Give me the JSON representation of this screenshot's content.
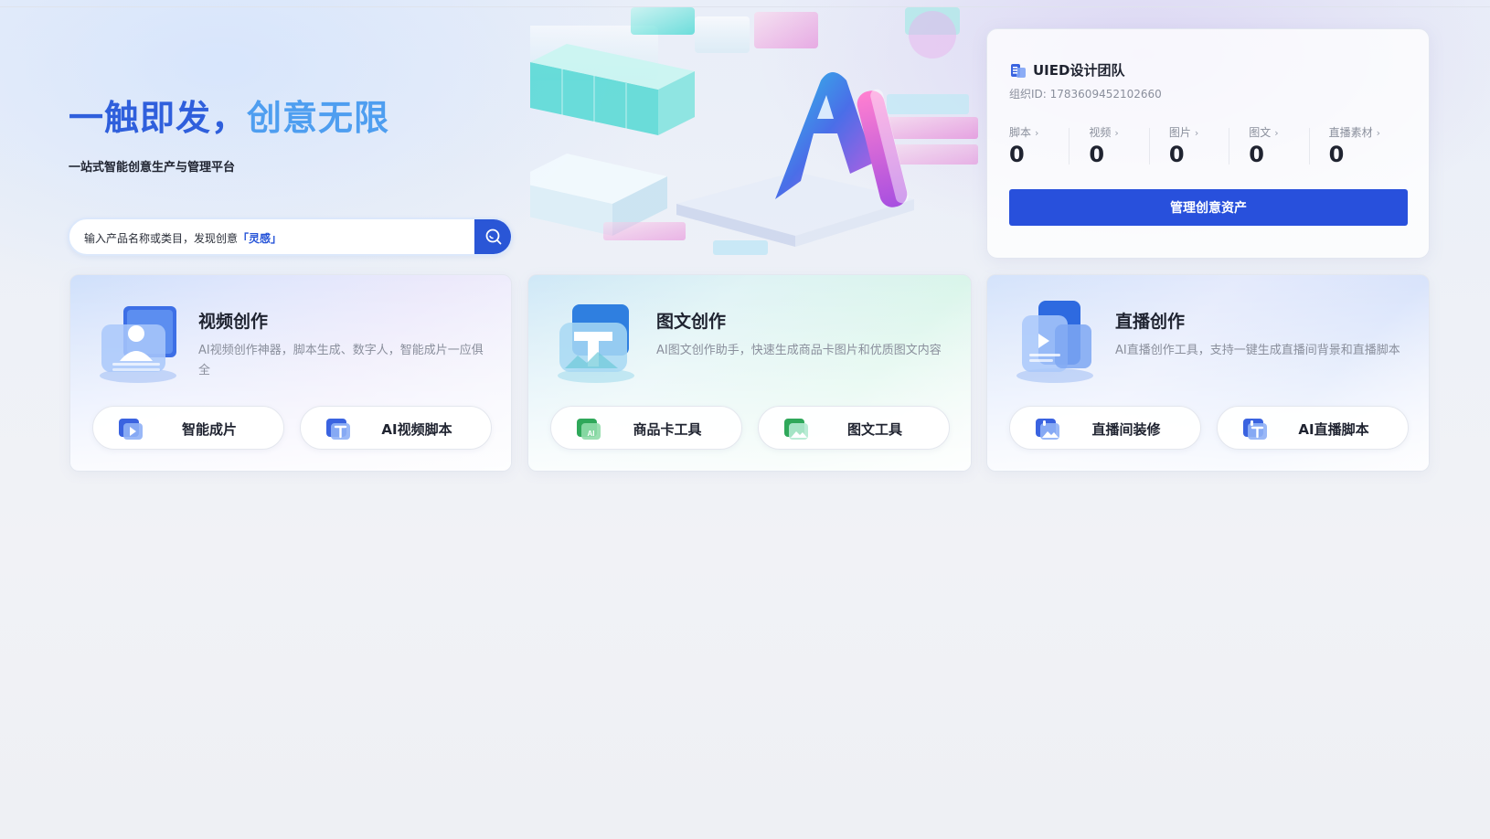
{
  "hero": {
    "title_part1": "一触即发，",
    "title_part2": "创意无限",
    "subtitle": "一站式智能创意生产与管理平台",
    "search_placeholder_text": "输入产品名称或类目，发现创意",
    "search_placeholder_highlight": "「灵感」"
  },
  "team": {
    "name": "UIED设计团队",
    "org_id": "组织ID: 1783609452102660",
    "stats": [
      {
        "label": "脚本",
        "value": "0"
      },
      {
        "label": "视频",
        "value": "0"
      },
      {
        "label": "图片",
        "value": "0"
      },
      {
        "label": "图文",
        "value": "0"
      },
      {
        "label": "直播素材",
        "value": "0"
      }
    ],
    "chevron": "›",
    "manage_button": "管理创意资产"
  },
  "cards": [
    {
      "title": "视频创作",
      "desc": "AI视频创作神器，脚本生成、数字人，智能成片一应俱全",
      "actions": [
        "智能成片",
        "AI视频脚本"
      ]
    },
    {
      "title": "图文创作",
      "desc": "AI图文创作助手，快速生成商品卡图片和优质图文内容",
      "actions": [
        "商品卡工具",
        "图文工具"
      ]
    },
    {
      "title": "直播创作",
      "desc": "AI直播创作工具，支持一键生成直播间背景和直播脚本",
      "actions": [
        "直播间装修",
        "AI直播脚本"
      ]
    }
  ],
  "colors": {
    "primary": "#2850dc",
    "title_blue": "#2f5fdc",
    "title_light_blue": "#4e9ef0",
    "text_dark": "#1f2330",
    "text_gray": "#8a8f9c",
    "green_icon": "#3dbb6a"
  },
  "icons": {
    "search": "search-icon",
    "team": "team-logo-icon",
    "video_card": "video-creation-illustration",
    "graphic_card": "graphic-creation-illustration",
    "live_card": "live-creation-illustration"
  }
}
